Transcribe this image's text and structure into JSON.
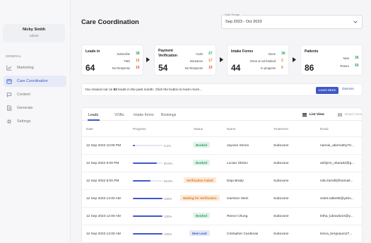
{
  "sidebar": {
    "user_name": "Nicky Smith",
    "user_role": "Admin",
    "section": "GENERAL",
    "items": [
      {
        "label": "Marketing",
        "icon": "chart-icon"
      },
      {
        "label": "Care Coordination",
        "icon": "calendar-icon",
        "active": true
      },
      {
        "label": "Content",
        "icon": "chat-icon"
      },
      {
        "label": "Generate",
        "icon": "document-icon"
      },
      {
        "label": "Settings",
        "icon": "gear-icon"
      }
    ]
  },
  "header": {
    "title": "Care Coordination",
    "date_range_label": "Date Range",
    "date_range_value": "Sep 2023 - Oct 2023"
  },
  "cards": {
    "leads": {
      "title": "Leads in",
      "total": "64",
      "rows": [
        {
          "label": "Subscribe",
          "value": "38"
        },
        {
          "label": "TMS",
          "value": "16"
        },
        {
          "label": "No Response",
          "value": "10"
        }
      ]
    },
    "payment": {
      "title": "Payment Verification",
      "total": "54",
      "rows": [
        {
          "label": "Cash",
          "value": "27"
        },
        {
          "label": "Insurance",
          "value": "17"
        },
        {
          "label": "No Response",
          "value": "10"
        }
      ]
    },
    "intake": {
      "title": "Intake Forms",
      "total": "44",
      "rows": [
        {
          "label": "Done",
          "value": "36"
        },
        {
          "label": "Done & not booked",
          "value": "2"
        },
        {
          "label": "In progress",
          "value": "6"
        }
      ]
    },
    "patients": {
      "title": "Patients",
      "total": "86",
      "rows": [
        {
          "label": "New",
          "value": "36"
        },
        {
          "label": "Return",
          "value": "50"
        }
      ]
    }
  },
  "banner": {
    "text_before": "You missed out on ",
    "count": "82",
    "text_after": " leads in the past month. Click the button to learn more...",
    "learn_more": "Learn More",
    "dismiss": "Dismiss"
  },
  "table": {
    "tabs": [
      "Leads",
      "VOBs",
      "Intake forms",
      "Bookings"
    ],
    "list_view": "List View",
    "board_view": "Board View",
    "columns": [
      "Date",
      "Progress",
      "Status",
      "Name",
      "Treatment",
      "Email"
    ],
    "rows": [
      {
        "date": "12 Sep 2023 10:00 PM",
        "progress": 0.082,
        "progress_label": "8.2%",
        "status": "Booked",
        "status_kind": "booked",
        "name": "Jayvion Simon",
        "treatment": "Suboxone",
        "email": "nannie_abernathy70..."
      },
      {
        "date": "12 Sep 2022 9:00 PM",
        "progress": 0.806,
        "progress_label": "80.6%",
        "status": "Booked",
        "status_kind": "booked",
        "name": "Lucian Obrien",
        "treatment": "Suboxone",
        "email": "ashlynn_ohara62@g..."
      },
      {
        "date": "12 Sep 2022 8:00 PM",
        "progress": 0.589,
        "progress_label": "58.9%",
        "status": "Verification Failed",
        "status_kind": "failed",
        "name": "Deja Brady",
        "treatment": "Suboxone",
        "email": "milo.farrell@hotmail..."
      },
      {
        "date": "12 Sep 2023 12:00 AM",
        "progress": 1.0,
        "progress_label": "100%",
        "status": "Waiting for Verification",
        "status_kind": "waiting",
        "name": "Harrison Stein",
        "treatment": "Suboxone",
        "email": "violet.ratke86@yaho..."
      },
      {
        "date": "12 Sep 2023 12:00 AM",
        "progress": 1.0,
        "progress_label": "100%",
        "status": "Booked",
        "status_kind": "booked",
        "name": "Reece Chung",
        "treatment": "Suboxone",
        "email": "letha_lubowitz24@y..."
      },
      {
        "date": "12 Sep 2023 12:00 AM",
        "progress": 1.0,
        "progress_label": "100%",
        "status": "New Lead",
        "status_kind": "newlead",
        "name": "Cristopher Cardenas",
        "treatment": "Suboxone",
        "email": "lenna_bergnaum27..."
      }
    ]
  }
}
